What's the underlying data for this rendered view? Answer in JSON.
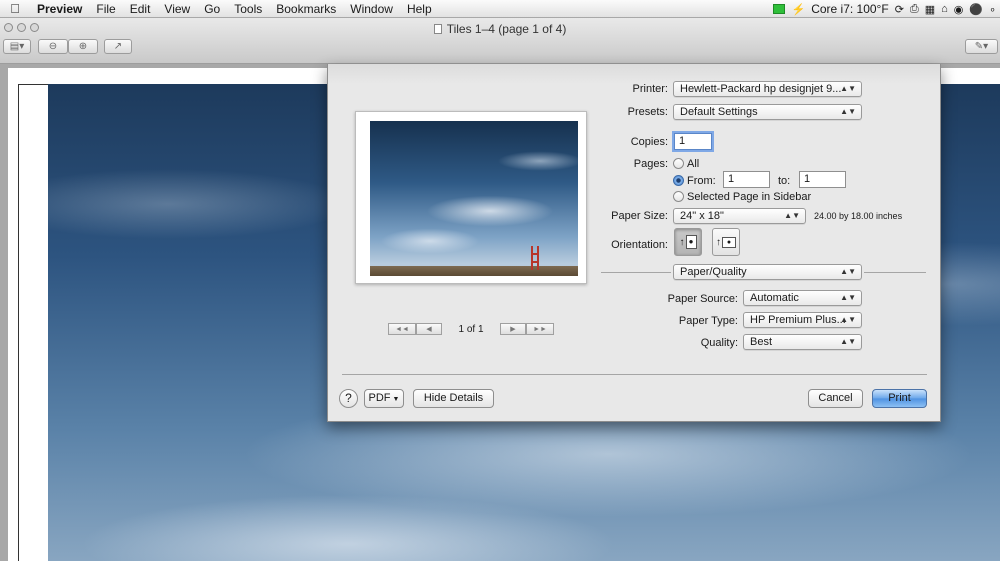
{
  "menubar": {
    "apple": "",
    "app_name": "Preview",
    "items": [
      "File",
      "Edit",
      "View",
      "Go",
      "Tools",
      "Bookmarks",
      "Window",
      "Help"
    ],
    "status_text": "Core i7: 100°F"
  },
  "window": {
    "title": "Tiles 1–4 (page 1 of 4)"
  },
  "print_dialog": {
    "printer_label": "Printer:",
    "printer_value": "Hewlett-Packard hp designjet 9...",
    "presets_label": "Presets:",
    "presets_value": "Default Settings",
    "copies_label": "Copies:",
    "copies_value": "1",
    "pages_label": "Pages:",
    "pages_all": "All",
    "pages_from": "From:",
    "pages_from_value": "1",
    "pages_to": "to:",
    "pages_to_value": "1",
    "pages_selected": "Selected Page in Sidebar",
    "paper_size_label": "Paper Size:",
    "paper_size_value": "24\" x 18\"",
    "paper_size_desc": "24.00 by 18.00 inches",
    "orientation_label": "Orientation:",
    "section_value": "Paper/Quality",
    "paper_source_label": "Paper Source:",
    "paper_source_value": "Automatic",
    "paper_type_label": "Paper Type:",
    "paper_type_value": "HP Premium Plus...",
    "quality_label": "Quality:",
    "quality_value": "Best",
    "pager_label": "1 of 1",
    "help_label": "?",
    "pdf_label": "PDF",
    "hide_details_label": "Hide Details",
    "cancel_label": "Cancel",
    "print_label": "Print"
  }
}
